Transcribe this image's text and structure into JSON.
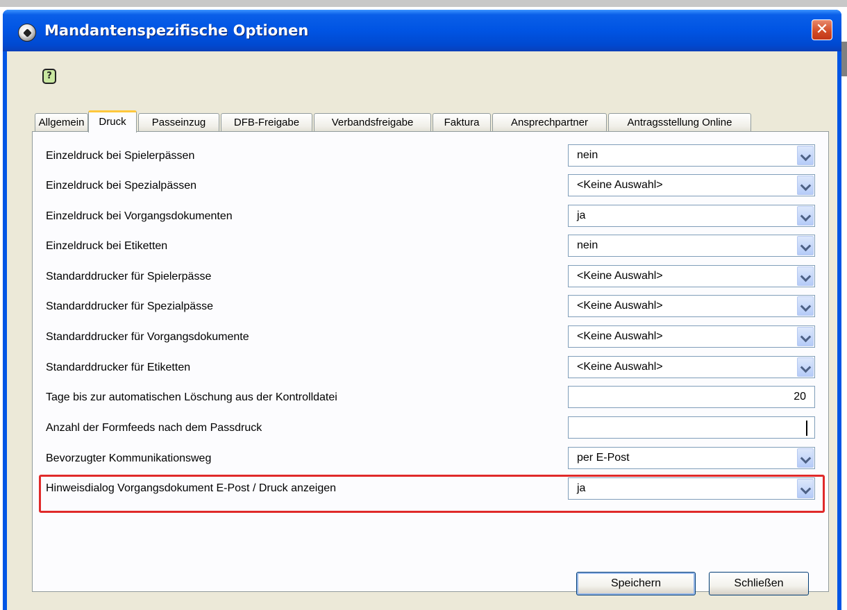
{
  "window": {
    "title": "Mandantenspezifische Optionen",
    "close_glyph": "✕"
  },
  "help": {
    "glyph": "?"
  },
  "tabs": [
    {
      "label": "Allgemein",
      "active": false
    },
    {
      "label": "Druck",
      "active": true
    },
    {
      "label": "Passeinzug",
      "active": false
    },
    {
      "label": "DFB-Freigabe",
      "active": false
    },
    {
      "label": "Verbandsfreigabe",
      "active": false
    },
    {
      "label": "Faktura",
      "active": false
    },
    {
      "label": "Ansprechpartner",
      "active": false
    },
    {
      "label": "Antragsstellung Online",
      "active": false
    }
  ],
  "settings": [
    {
      "label": "Einzeldruck bei Spielerpässen",
      "type": "select",
      "value": "nein"
    },
    {
      "label": "Einzeldruck bei Spezialpässen",
      "type": "select",
      "value": "<Keine Auswahl>"
    },
    {
      "label": "Einzeldruck bei Vorgangsdokumenten",
      "type": "select",
      "value": "ja"
    },
    {
      "label": "Einzeldruck bei Etiketten",
      "type": "select",
      "value": "nein"
    },
    {
      "label": "Standarddrucker für Spielerpässe",
      "type": "select",
      "value": "<Keine Auswahl>"
    },
    {
      "label": "Standarddrucker für Spezialpässe",
      "type": "select",
      "value": "<Keine Auswahl>"
    },
    {
      "label": "Standarddrucker für Vorgangsdokumente",
      "type": "select",
      "value": "<Keine Auswahl>"
    },
    {
      "label": "Standarddrucker für Etiketten",
      "type": "select",
      "value": "<Keine Auswahl>"
    },
    {
      "label": "Tage bis zur automatischen Löschung aus der Kontrolldatei",
      "type": "text",
      "value": "20"
    },
    {
      "label": "Anzahl der Formfeeds nach dem Passdruck",
      "type": "text",
      "value": ""
    },
    {
      "label": "Bevorzugter Kommunikationsweg",
      "type": "select",
      "value": "per E-Post"
    },
    {
      "label": "Hinweisdialog Vorgangsdokument E-Post / Druck anzeigen",
      "type": "select",
      "value": "ja"
    }
  ],
  "buttons": {
    "save": "Speichern",
    "close": "Schließen"
  },
  "colors": {
    "highlight": "#e02a2a",
    "titlebar": "#0054e3",
    "active_tab_accent": "#ffc83c"
  }
}
